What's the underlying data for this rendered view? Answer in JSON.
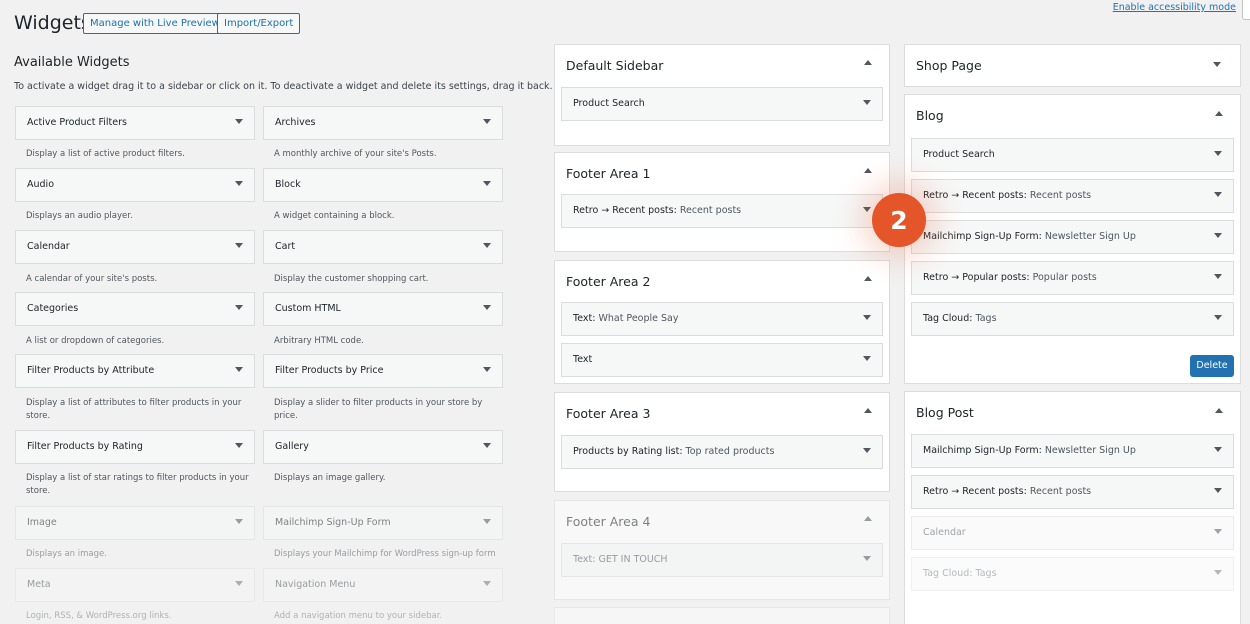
{
  "header": {
    "title": "Widgets",
    "live_preview_label": "Manage with Live Preview",
    "import_export_label": "Import/Export",
    "accessibility_link": "Enable accessibility mode"
  },
  "available": {
    "title": "Available Widgets",
    "description": "To activate a widget drag it to a sidebar or click on it. To deactivate a widget and delete its settings, drag it back.",
    "widgets": [
      {
        "name": "Active Product Filters",
        "desc": "Display a list of active product filters."
      },
      {
        "name": "Archives",
        "desc": "A monthly archive of your site's Posts."
      },
      {
        "name": "Audio",
        "desc": "Displays an audio player."
      },
      {
        "name": "Block",
        "desc": "A widget containing a block."
      },
      {
        "name": "Calendar",
        "desc": "A calendar of your site's posts."
      },
      {
        "name": "Cart",
        "desc": "Display the customer shopping cart."
      },
      {
        "name": "Categories",
        "desc": "A list or dropdown of categories."
      },
      {
        "name": "Custom HTML",
        "desc": "Arbitrary HTML code."
      },
      {
        "name": "Filter Products by Attribute",
        "desc": "Display a list of attributes to filter products in your store."
      },
      {
        "name": "Filter Products by Price",
        "desc": "Display a slider to filter products in your store by price."
      },
      {
        "name": "Filter Products by Rating",
        "desc": "Display a list of star ratings to filter products in your store."
      },
      {
        "name": "Gallery",
        "desc": "Displays an image gallery."
      },
      {
        "name": "Image",
        "desc": "Displays an image."
      },
      {
        "name": "Mailchimp Sign-Up Form",
        "desc": "Displays your Mailchimp for WordPress sign-up form"
      },
      {
        "name": "Meta",
        "desc": "Login, RSS, & WordPress.org links."
      },
      {
        "name": "Navigation Menu",
        "desc": "Add a navigation menu to your sidebar."
      }
    ]
  },
  "sidebars_middle": [
    {
      "title": "Default Sidebar",
      "items": [
        {
          "name": "Product Search",
          "sub": ""
        }
      ]
    },
    {
      "title": "Footer Area 1",
      "items": [
        {
          "name": "Retro → Recent posts:",
          "sub": "Recent posts"
        }
      ]
    },
    {
      "title": "Footer Area 2",
      "items": [
        {
          "name": "Text:",
          "sub": "What People Say"
        },
        {
          "name": "Text",
          "sub": ""
        }
      ]
    },
    {
      "title": "Footer Area 3",
      "items": [
        {
          "name": "Products by Rating list:",
          "sub": "Top rated products"
        }
      ]
    },
    {
      "title": "Footer Area 4",
      "items": [
        {
          "name": "Text:",
          "sub": "GET IN TOUCH"
        }
      ]
    }
  ],
  "sidebars_right": [
    {
      "title": "Shop Page",
      "items": []
    },
    {
      "title": "Blog",
      "items": [
        {
          "name": "Product Search",
          "sub": ""
        },
        {
          "name": "Retro → Recent posts:",
          "sub": "Recent posts"
        },
        {
          "name": "Mailchimp Sign-Up Form:",
          "sub": "Newsletter Sign Up"
        },
        {
          "name": "Retro → Popular posts:",
          "sub": "Popular posts"
        },
        {
          "name": "Tag Cloud:",
          "sub": "Tags"
        }
      ],
      "delete_label": "Delete"
    },
    {
      "title": "Blog Post",
      "items": [
        {
          "name": "Mailchimp Sign-Up Form:",
          "sub": "Newsletter Sign Up"
        },
        {
          "name": "Retro → Recent posts:",
          "sub": "Recent posts"
        },
        {
          "name": "Calendar",
          "sub": ""
        },
        {
          "name": "Tag Cloud:",
          "sub": "Tags"
        }
      ]
    }
  ],
  "step_badge": "2",
  "colors": {
    "accent": "#2271b1",
    "badge": "#e4552a",
    "background": "#f1f1f1"
  }
}
